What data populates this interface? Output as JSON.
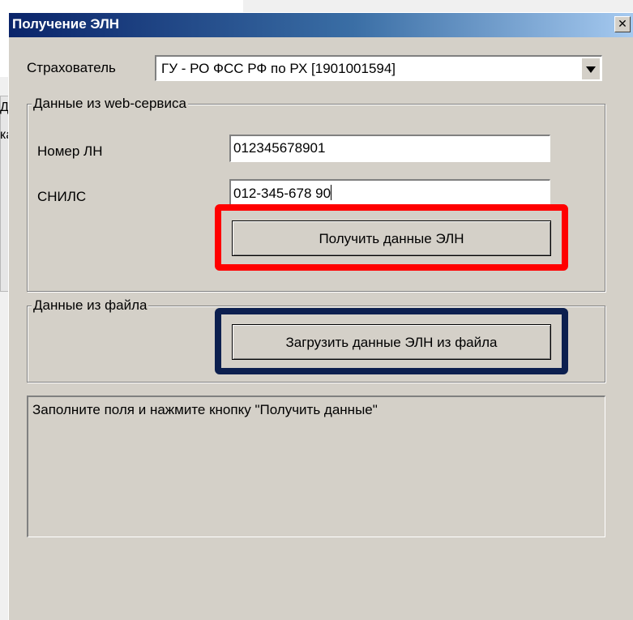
{
  "background_fragments": {
    "left_label_fragment": "Д",
    "left_text_fragment": "ка"
  },
  "dialog": {
    "title": "Получение ЭЛН",
    "close_glyph": "✕"
  },
  "insurer": {
    "label": "Страхователь",
    "selected_value": "ГУ - РО ФСС РФ по РХ [1901001594]"
  },
  "web_service_group": {
    "legend": "Данные из web-сервиса",
    "ln_number_label": "Номер ЛН",
    "ln_number_value": "012345678901",
    "snils_label": "СНИЛС",
    "snils_value": "012-345-678 90",
    "get_button_label": "Получить данные ЭЛН"
  },
  "file_group": {
    "legend": "Данные из файла",
    "load_button_label": "Загрузить данные ЭЛН из файла"
  },
  "status": {
    "message": "Заполните поля и нажмите кнопку \"Получить данные\""
  },
  "highlight_colors": {
    "get_button": "#ff0000",
    "load_button": "#0c1f4f"
  }
}
